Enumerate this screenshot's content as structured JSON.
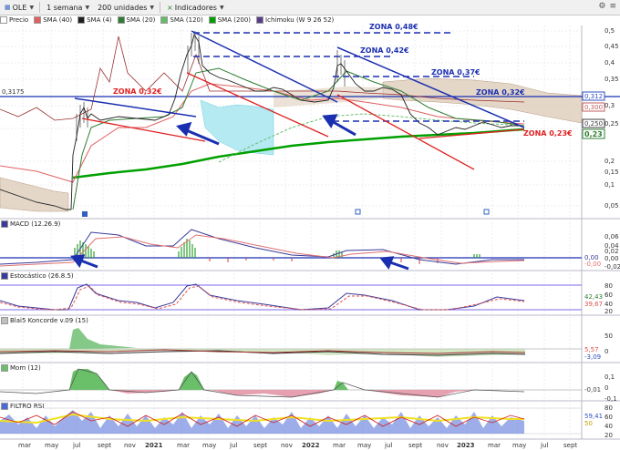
{
  "toolbar": {
    "symbol": "OLE",
    "period": "1 semana",
    "units": "200 unidades",
    "indicators": "Indicadores"
  },
  "legend": {
    "items": [
      {
        "label": "Precio",
        "color": "#ffffff"
      },
      {
        "label": "SMA (40)",
        "color": "#e06060"
      },
      {
        "label": "SMA (4)",
        "color": "#202020"
      },
      {
        "label": "SMA (20)",
        "color": "#2e7d32"
      },
      {
        "label": "SMA (120)",
        "color": "#66bb6a"
      },
      {
        "label": "SMA (200)",
        "color": "#00a000"
      },
      {
        "label": "Ichimoku (W 9 26 52)",
        "color": "#5a3d8a"
      }
    ]
  },
  "price_axis": {
    "ticks": [
      "0,5",
      "0,45",
      "0,4",
      "0,35",
      "0,3",
      "0,25",
      "0,2",
      "0,15",
      "0,1",
      "0,05"
    ],
    "level_line_label": "0,3175",
    "right_badges": [
      {
        "text": "0,312",
        "color": "#3050c0"
      },
      {
        "text": "0,300",
        "color": "#c06060"
      },
      {
        "text": "0,250",
        "color": "#404040"
      },
      {
        "text": "0,23",
        "color": "#2e7d32"
      }
    ]
  },
  "zones": [
    {
      "label": "ZONA 0,48€",
      "color": "#1a2fb0"
    },
    {
      "label": "ZONA 0,42€",
      "color": "#1a2fb0"
    },
    {
      "label": "ZONA 0,37€",
      "color": "#1a2fb0"
    },
    {
      "label": "ZONA 0,32€",
      "color": "#1a2fb0"
    },
    {
      "label": "ZONA 0,32€",
      "color": "#e02020"
    },
    {
      "label": "ZONA 0,23€",
      "color": "#e02020"
    }
  ],
  "panes": {
    "macd": {
      "title": "MACD (12.26.9)",
      "ticks": [
        "0,06",
        "0,04",
        "0,02",
        "0,00",
        "-0,02"
      ],
      "badges": [
        "0,00",
        "-0,00"
      ]
    },
    "stoch": {
      "title": "Estocástico (26.8.5)",
      "ticks": [
        "80",
        "60",
        "40",
        "20"
      ],
      "badges": [
        "42,43",
        "39,67"
      ]
    },
    "koncorde": {
      "title": "Blai5 Koncorde v.09 (15)",
      "ticks": [
        "50",
        "0"
      ],
      "badges": [
        "5,57",
        "-3,09"
      ]
    },
    "mom": {
      "title": "Mom (12)",
      "ticks": [
        "0,1",
        "0",
        "-0,1"
      ],
      "badges": [
        "-0,01"
      ]
    },
    "rsi": {
      "title": "FILTRO RSI",
      "ticks": [
        "80",
        "60",
        "40",
        "20"
      ],
      "badges": [
        "59,41",
        "50"
      ]
    }
  },
  "xaxis": {
    "labels": [
      "mar",
      "may",
      "jul",
      "sept",
      "nov",
      "2021",
      "mar",
      "may",
      "jul",
      "sept",
      "nov",
      "2022",
      "mar",
      "may",
      "jul",
      "sept",
      "nov",
      "2023",
      "mar",
      "may",
      "jul",
      "sept"
    ]
  }
}
